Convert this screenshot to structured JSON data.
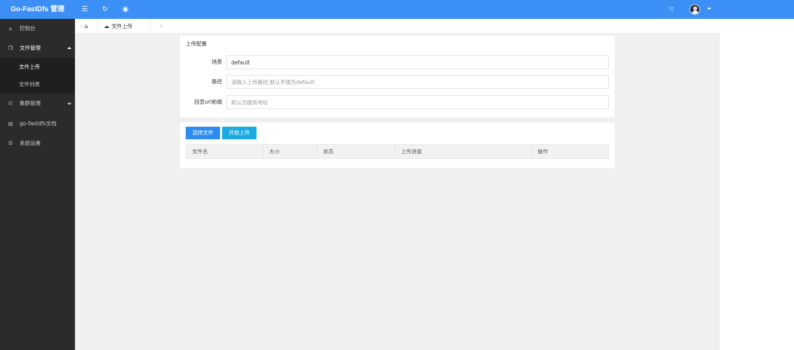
{
  "header": {
    "logo": "Go-FastDfs 管理",
    "icons": [
      "menu-icon",
      "refresh-icon",
      "target-icon",
      "fullscreen-icon"
    ],
    "brand_color": "#3c8ff5"
  },
  "sidebar": {
    "items": [
      {
        "icon": "home-icon",
        "label": "控制台"
      },
      {
        "icon": "files-icon",
        "label": "文件管理",
        "expanded": true,
        "children": [
          {
            "label": "文件上传",
            "active": true
          },
          {
            "label": "文件列表"
          }
        ]
      },
      {
        "icon": "cluster-icon",
        "label": "集群管理",
        "expanded": false
      },
      {
        "icon": "book-icon",
        "label": "go-fastdfs文档"
      },
      {
        "icon": "settings-icon",
        "label": "系统设置"
      }
    ]
  },
  "tabs": {
    "home_icon": "home-icon",
    "items": [
      {
        "icon": "cloud-upload-icon",
        "label": "文件上传",
        "close": "×"
      }
    ]
  },
  "upload_config": {
    "title": "上传配置",
    "scene": {
      "label": "场景",
      "value": "default",
      "placeholder": ""
    },
    "path": {
      "label": "路径",
      "value": "",
      "placeholder": "请输入上传路径,默认不填为default"
    },
    "url_prefix": {
      "label": "回显url前缀",
      "value": "",
      "placeholder": "默认为服务地址"
    }
  },
  "upload_list": {
    "select_button": "选择文件",
    "start_button": "开始上传",
    "columns": [
      "文件名",
      "大小",
      "状态",
      "上传进度",
      "操作"
    ]
  }
}
